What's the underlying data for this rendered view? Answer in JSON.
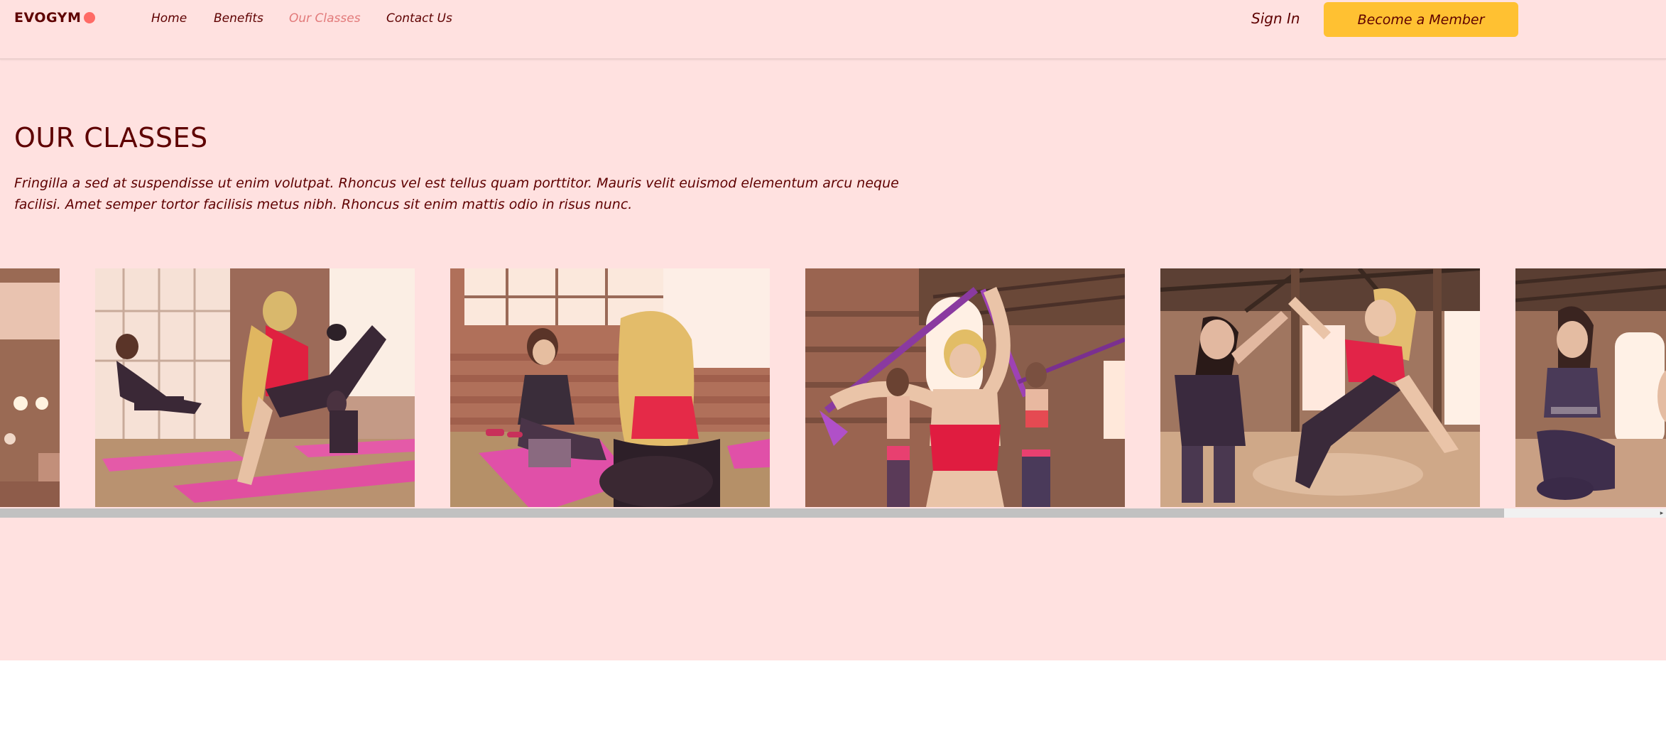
{
  "brand": {
    "name": "EVOGYM",
    "dot_color": "#ff6b66"
  },
  "nav": {
    "items": [
      {
        "label": "Home",
        "active": false
      },
      {
        "label": "Benefits",
        "active": false
      },
      {
        "label": "Our Classes",
        "active": true
      },
      {
        "label": "Contact Us",
        "active": false
      }
    ],
    "sign_in": "Sign In",
    "cta": "Become a Member"
  },
  "colors": {
    "background": "#ffe1e0",
    "primary_text": "#5e0000",
    "active_link": "#e27a7a",
    "cta": "#ffc132"
  },
  "section": {
    "title": "OUR CLASSES",
    "description": "Fringilla a sed at suspendisse ut enim volutpat. Rhoncus vel est tellus quam porttitor. Mauris velit euismod elementum arcu neque facilisi. Amet semper tortor facilisis metus nibh. Rhoncus sit enim mattis odio in risus nunc."
  },
  "carousel": {
    "images": [
      {
        "subject": "gym class photo (partially visible)"
      },
      {
        "subject": "women doing kickback exercise on mats"
      },
      {
        "subject": "two women sitting on mats in conversation"
      },
      {
        "subject": "women stretching with resistance bands"
      },
      {
        "subject": "two women giving high five in plank"
      },
      {
        "subject": "woman kneeling on floor (partially visible)"
      }
    ],
    "scroll_fraction_visible": 0.9
  }
}
